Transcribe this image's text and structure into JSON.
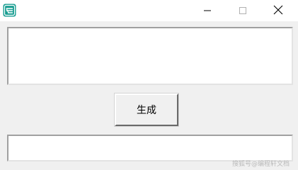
{
  "window": {
    "controls": {
      "minimize_icon": "minimize-icon",
      "maximize_icon": "maximize-icon",
      "close_icon": "close-icon"
    }
  },
  "main": {
    "input_text": "",
    "generate_button_label": "生成",
    "output_text": ""
  },
  "watermark": "搜狐号@编程轩文档",
  "colors": {
    "app_icon": "#1a9e92",
    "background": "#f0f0f0",
    "titlebar": "#ffffff"
  }
}
